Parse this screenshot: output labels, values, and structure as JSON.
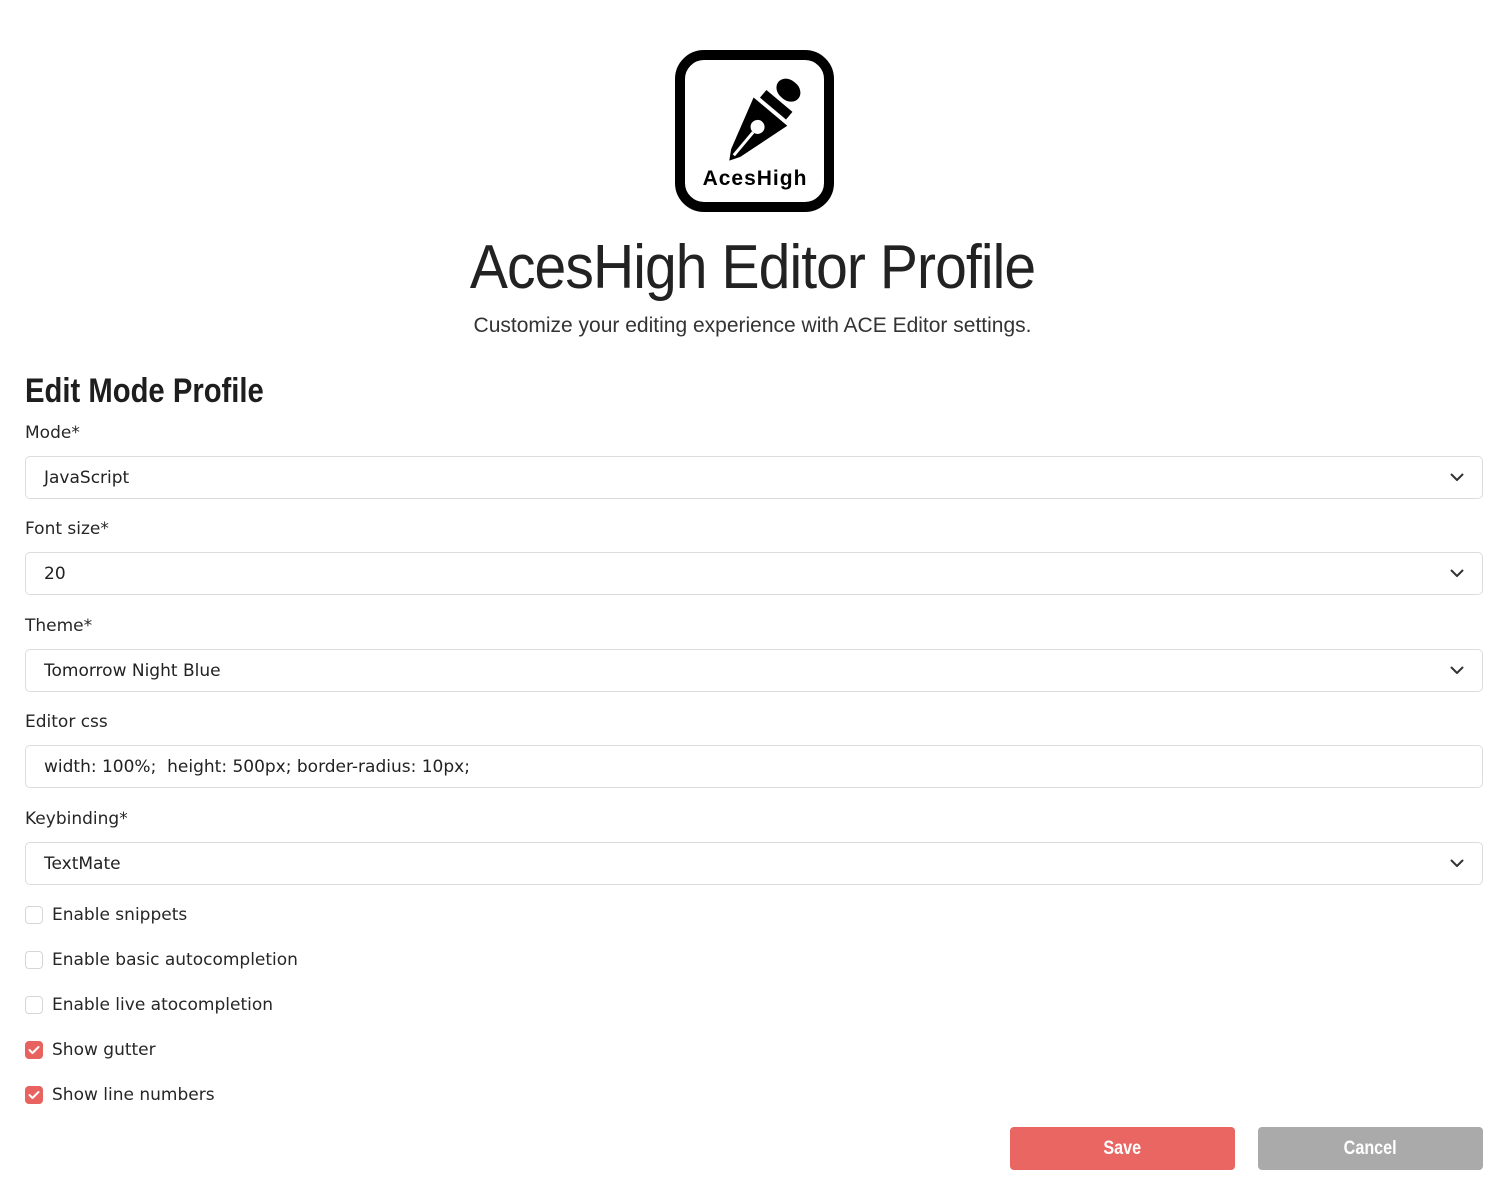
{
  "header": {
    "logo_text": "AcesHigh",
    "title": "AcesHigh Editor Profile",
    "subtitle": "Customize your editing experience with ACE Editor settings."
  },
  "form": {
    "section_title": "Edit Mode Profile",
    "mode": {
      "label": "Mode*",
      "value": "JavaScript"
    },
    "font_size": {
      "label": "Font size*",
      "value": "20"
    },
    "theme": {
      "label": "Theme*",
      "value": "Tomorrow Night Blue"
    },
    "editor_css": {
      "label": "Editor css",
      "value": "width: 100%;  height: 500px; border-radius: 10px;"
    },
    "keybinding": {
      "label": "Keybinding*",
      "value": "TextMate"
    },
    "checkboxes": [
      {
        "label": "Enable snippets",
        "checked": false
      },
      {
        "label": "Enable basic autocompletion",
        "checked": false
      },
      {
        "label": "Enable live atocompletion",
        "checked": false
      },
      {
        "label": "Show gutter",
        "checked": true
      },
      {
        "label": "Show line numbers",
        "checked": true
      }
    ]
  },
  "actions": {
    "save_label": "Save",
    "cancel_label": "Cancel"
  },
  "colors": {
    "accent": "#e8625f",
    "save": "#ea6662",
    "cancel": "#aaaaaa"
  },
  "icons": {
    "logo": "pen-nib-icon",
    "dropdown": "chevron-down-icon",
    "check": "checkmark-icon"
  }
}
